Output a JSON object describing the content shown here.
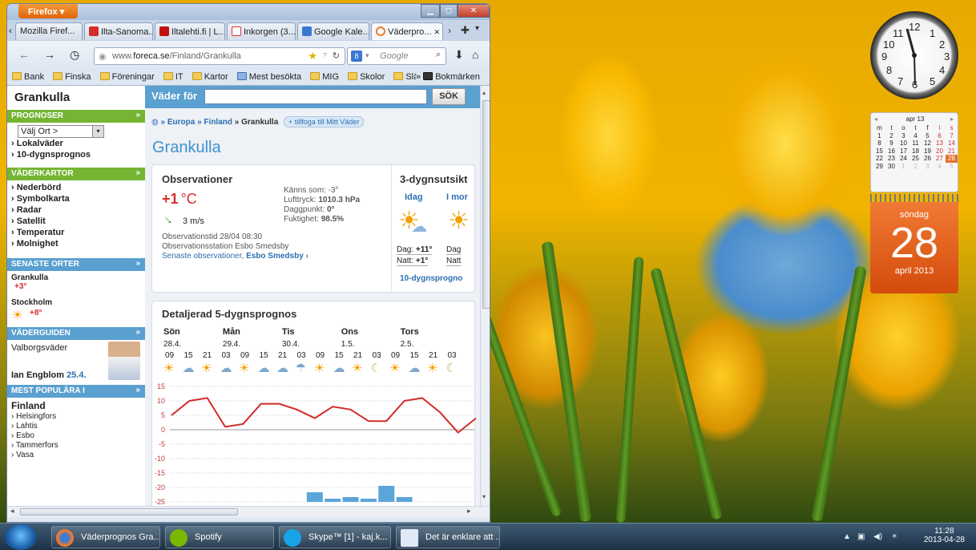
{
  "browser": {
    "app_button": "Firefox",
    "tabs": [
      "Mozilla Firef...",
      "Ilta-Sanoma...",
      "Iltalehti.fi | L...",
      "Inkorgen (3...",
      "Google Kale...",
      "Väderpro..."
    ],
    "url_host": "www.",
    "url_domain": "foreca.se",
    "url_path": "/Finland/Grankulla",
    "search_placeholder": "Google",
    "bookmarks": [
      "Bank",
      "Finska",
      "Föreningar",
      "IT",
      "Kartor",
      "Mest besökta",
      "MIG",
      "Skolor",
      "Släkt"
    ],
    "bookmarks_more": "Bokmärken"
  },
  "sidebar": {
    "site_title": "Grankulla",
    "prognoser_head": "PROGNOSER",
    "select_value": "Välj Ort >",
    "prognoser_links": [
      "› Lokalväder",
      "› 10-dygnsprognos"
    ],
    "kartor_head": "VÄDERKARTOR",
    "kartor_links": [
      "› Nederbörd",
      "› Symbolkarta",
      "› Radar",
      "› Satellit",
      "› Temperatur",
      "› Molnighet"
    ],
    "senaste_head": "SENASTE ORTER",
    "recent": [
      {
        "name": "Grankulla",
        "temp": "+3°"
      },
      {
        "name": "Stockholm",
        "temp": "+8°"
      }
    ],
    "guide_head": "VÄDERGUIDEN",
    "guide_title": "Valborgsväder",
    "guide_author": "Ian Engblom",
    "guide_date": "25.4.",
    "popular_head": "MEST POPULÄRA I",
    "popular_country": "Finland",
    "popular_links": [
      "› Helsingfors",
      "› Lahtis",
      "› Esbo",
      "› Tammerfors",
      "› Vasa"
    ]
  },
  "main": {
    "search_label": "Väder för",
    "search_button": "SÖK",
    "breadcrumb_europa": "» Europa",
    "breadcrumb_finland": "» Finland",
    "breadcrumb_city": "» Grankulla",
    "add_pill": "+ tillfoga till Mitt Väder",
    "title": "Grankulla",
    "obs": {
      "heading": "Observationer",
      "temp": "+1",
      "unit": "°C",
      "wind": "3 m/s",
      "feels_label": "Känns som:",
      "feels": "-3°",
      "pressure_label": "Lufttryck:",
      "pressure": "1010.3 hPa",
      "dew_label": "Daggpunkt:",
      "dew": "0°",
      "humidity_label": "Fuktighet:",
      "humidity": "98.5%",
      "time": "Observationstid 28/04 08:30",
      "station": "Observationsstation Esbo Smedsby",
      "latest_link": "Senaste observationer,",
      "latest_station": "Esbo Smedsby ›"
    },
    "outlook": {
      "heading": "3-dygnsutsikt",
      "col1": "Idag",
      "col2": "I mor",
      "day_label": "Dag:",
      "day1": "+11°",
      "day2": "Dag",
      "night_label": "Natt:",
      "night1": "+1°",
      "night2": "Natt",
      "link": "10-dygnsprogno"
    },
    "detail": {
      "heading": "Detaljerad 5-dygnsprognos",
      "days": [
        "Sön",
        "Mån",
        "Tis",
        "Ons",
        "Tors"
      ],
      "dates": [
        "28.4.",
        "29.4.",
        "30.4.",
        "1.5.",
        "2.5."
      ],
      "hours": [
        "09",
        "15",
        "21",
        "03",
        "09",
        "15",
        "21",
        "03",
        "09",
        "15",
        "21",
        "03",
        "09",
        "15",
        "21",
        "03"
      ],
      "y_ticks": [
        "15",
        "10",
        "5",
        "0",
        "-5",
        "-10",
        "-15",
        "-20",
        "-25"
      ]
    }
  },
  "chart_data": {
    "type": "line",
    "title": "",
    "xlabel": "",
    "ylabel": "",
    "ylim": [
      -25,
      15
    ],
    "x": [
      "Sön 09",
      "Sön 15",
      "Sön 21",
      "Mån 03",
      "Mån 09",
      "Mån 15",
      "Mån 21",
      "Tis 03",
      "Tis 09",
      "Tis 15",
      "Tis 21",
      "Ons 03",
      "Ons 09",
      "Ons 15",
      "Ons 21",
      "Tors 03",
      "Tors 09"
    ],
    "series": [
      {
        "values": [
          5,
          10,
          11,
          1,
          2,
          9,
          9,
          7,
          4,
          8,
          7,
          3,
          3,
          10,
          11,
          6,
          -1,
          4
        ]
      }
    ],
    "precip_bars": [
      {
        "x": "Tis 09",
        "value": 3
      },
      {
        "x": "Tis 15",
        "value": 1
      },
      {
        "x": "Tis 21",
        "value": 1.5
      },
      {
        "x": "Ons 03",
        "value": 1
      },
      {
        "x": "Ons 09",
        "value": 5
      },
      {
        "x": "Ons 15",
        "value": 1.5
      }
    ],
    "colors": {
      "line": "#d22a2a",
      "bars": "#5aa6da"
    }
  },
  "taskbar": {
    "items": [
      "Väderprognos Gra...",
      "Spotify",
      "Skype™ [1] - kaj.k...",
      "Det är enklare att ..."
    ],
    "time": "11:28",
    "date": "2013-04-28"
  },
  "gadgets": {
    "cal_month": "apr 13",
    "weekdays": [
      "m",
      "t",
      "o",
      "t",
      "f",
      "l",
      "s"
    ],
    "weeks": [
      [
        "1",
        "2",
        "3",
        "4",
        "5",
        "6",
        "7"
      ],
      [
        "8",
        "9",
        "10",
        "11",
        "12",
        "13",
        "14"
      ],
      [
        "15",
        "16",
        "17",
        "18",
        "19",
        "20",
        "21"
      ],
      [
        "22",
        "23",
        "24",
        "25",
        "26",
        "27",
        "28"
      ],
      [
        "29",
        "30",
        "1",
        "2",
        "3",
        "4",
        "5"
      ]
    ],
    "weekday_name": "söndag",
    "day_number": "28",
    "month_year": "april 2013",
    "clock_numbers": [
      "12",
      "1",
      "2",
      "3",
      "4",
      "5",
      "6",
      "7",
      "8",
      "9",
      "10",
      "11"
    ]
  }
}
